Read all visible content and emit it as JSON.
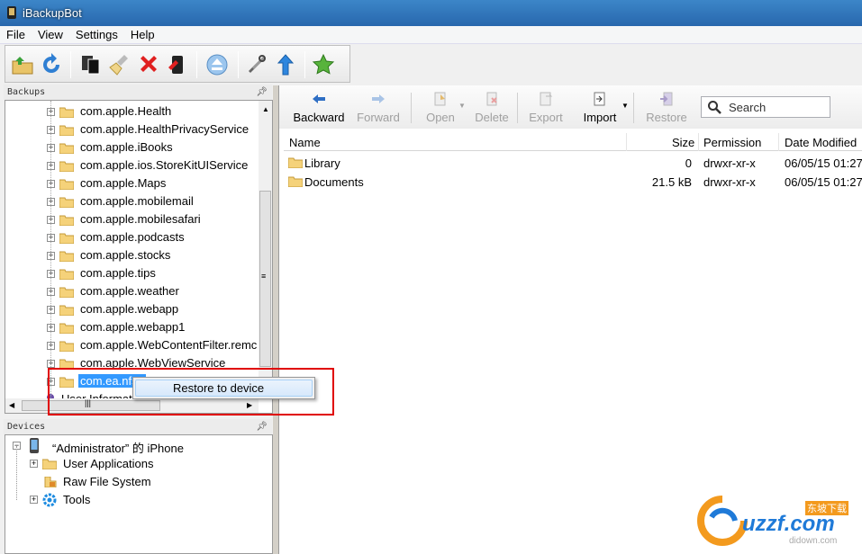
{
  "window": {
    "title": "iBackupBot"
  },
  "menu": [
    "File",
    "View",
    "Settings",
    "Help"
  ],
  "backups_panel": {
    "header": "Backups",
    "items": [
      "com.apple.Health",
      "com.apple.HealthPrivacyService",
      "com.apple.iBooks",
      "com.apple.ios.StoreKitUIService",
      "com.apple.Maps",
      "com.apple.mobilemail",
      "com.apple.mobilesafari",
      "com.apple.podcasts",
      "com.apple.stocks",
      "com.apple.tips",
      "com.apple.weather",
      "com.apple.webapp",
      "com.apple.webapp1",
      "com.apple.WebContentFilter.remc",
      "com.apple.WebViewService",
      "com.ea.nfs1"
    ],
    "partial_item": "User Information"
  },
  "context_menu": {
    "restore": "Restore to device"
  },
  "devices_panel": {
    "header": "Devices",
    "device": "“Administrator” 的 iPhone",
    "children": [
      "User Applications",
      "Raw File System",
      "Tools"
    ]
  },
  "file_toolbar": {
    "backward": "Backward",
    "forward": "Forward",
    "open": "Open",
    "delete": "Delete",
    "export": "Export",
    "import": "Import",
    "restore": "Restore",
    "search_placeholder": "Search"
  },
  "file_table": {
    "columns": [
      "Name",
      "Size",
      "Permission",
      "Date Modified"
    ],
    "rows": [
      {
        "name": "Library",
        "size": "0",
        "permission": "drwxr-xr-x",
        "date": "06/05/15 01:27"
      },
      {
        "name": "Documents",
        "size": "21.5 kB",
        "permission": "drwxr-xr-x",
        "date": "06/05/15 01:27"
      }
    ]
  },
  "watermark": {
    "brand": "uzzf.com",
    "cn": "东坡下载",
    "sub": "didown.com"
  }
}
